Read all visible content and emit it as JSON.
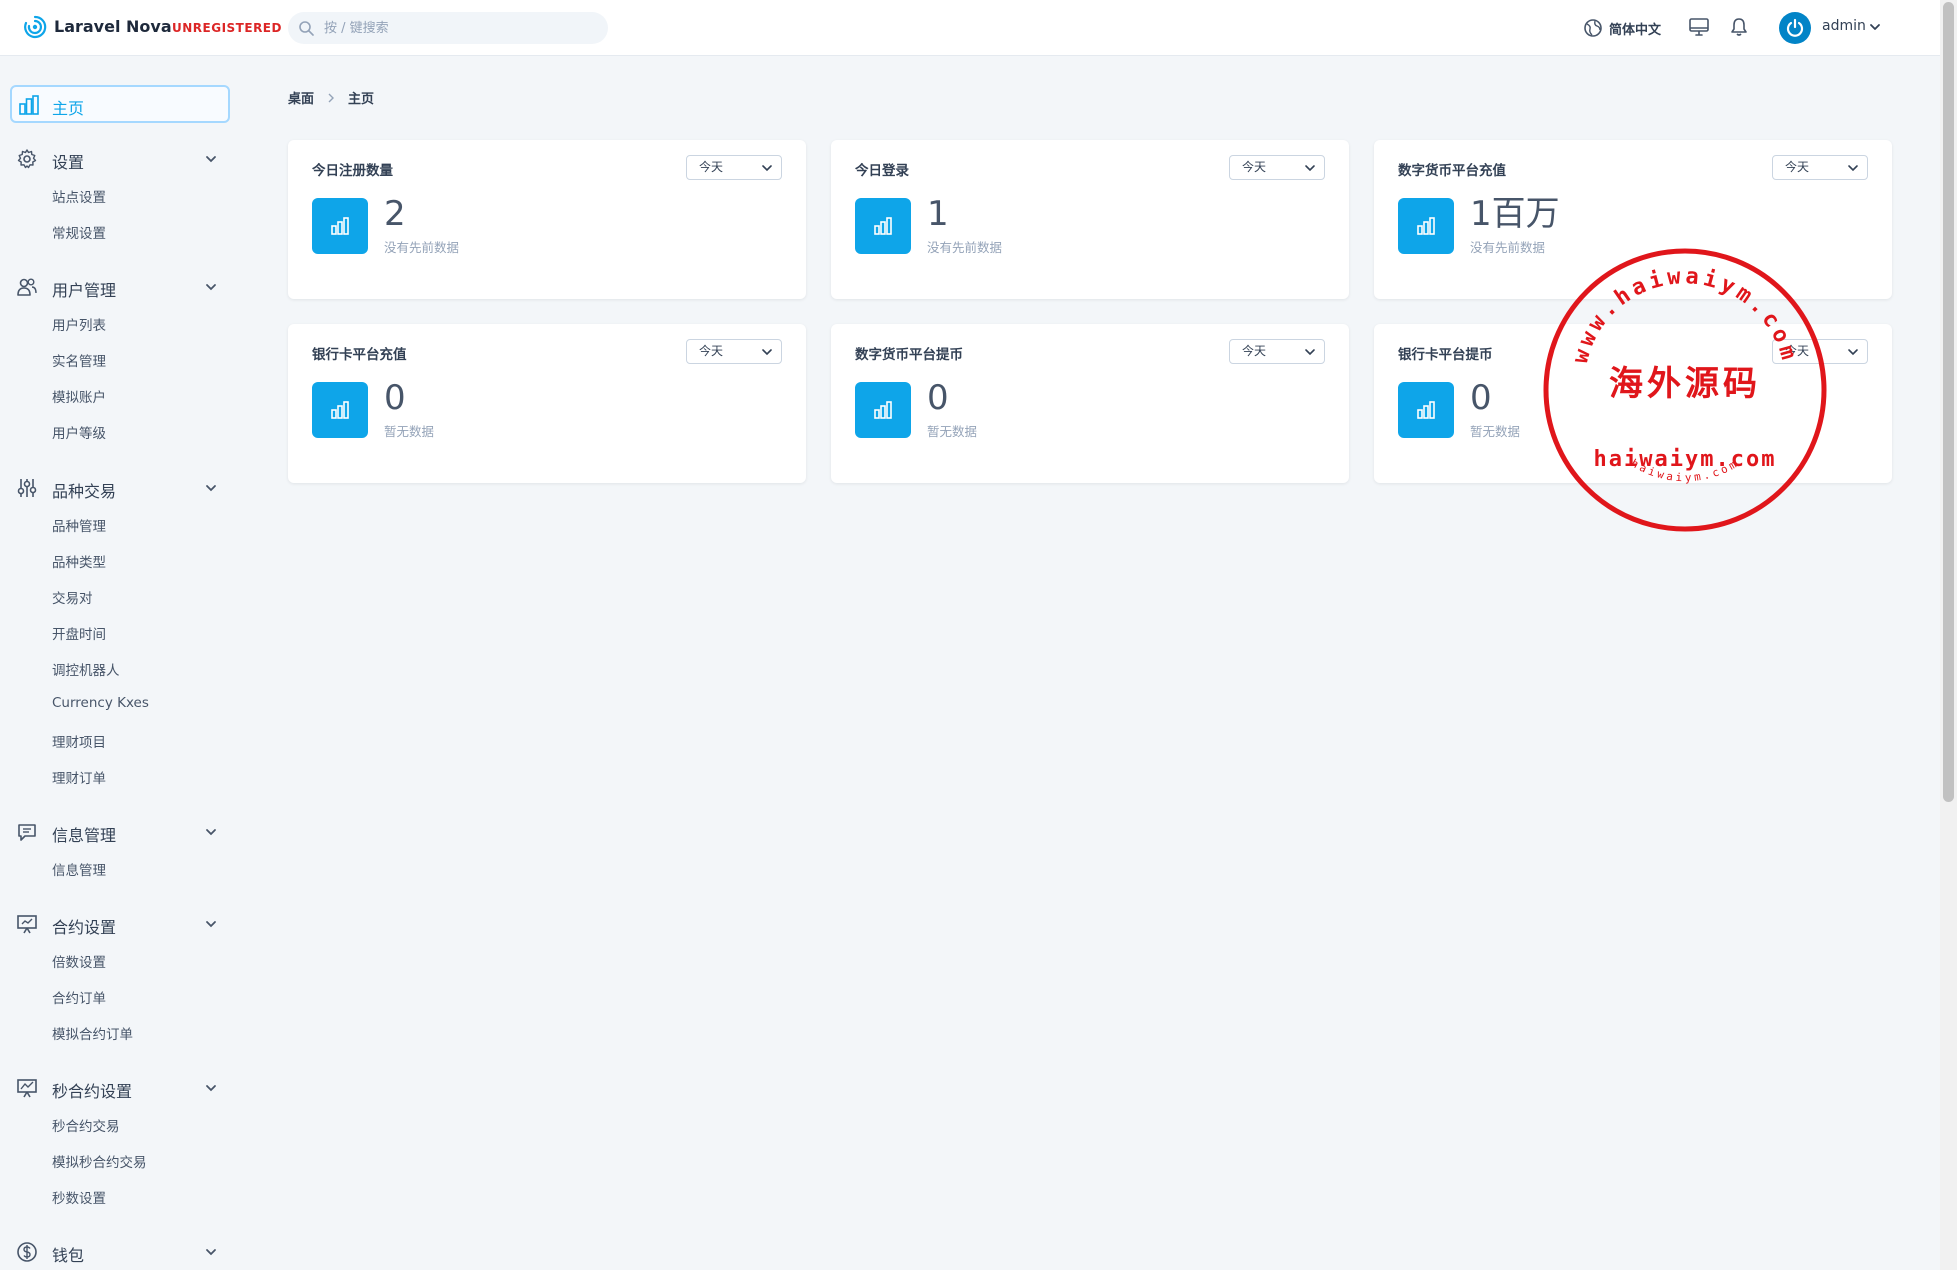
{
  "app": {
    "name": "Laravel Nova",
    "badge": "UNREGISTERED"
  },
  "search": {
    "placeholder": "按 / 键搜索"
  },
  "header": {
    "language": "简体中文",
    "user": "admin"
  },
  "sidebar": {
    "home": "主页",
    "groups": [
      {
        "label": "设置",
        "icon": "gear-icon",
        "items": [
          "站点设置",
          "常规设置"
        ]
      },
      {
        "label": "用户管理",
        "icon": "users-icon",
        "items": [
          "用户列表",
          "实名管理",
          "模拟账户",
          "用户等级"
        ]
      },
      {
        "label": "品种交易",
        "icon": "sliders-icon",
        "items": [
          "品种管理",
          "品种类型",
          "交易对",
          "开盘时间",
          "调控机器人",
          "Currency Kxes",
          "理财项目",
          "理财订单"
        ]
      },
      {
        "label": "信息管理",
        "icon": "message-icon",
        "items": [
          "信息管理"
        ]
      },
      {
        "label": "合约设置",
        "icon": "presentation-icon",
        "items": [
          "倍数设置",
          "合约订单",
          "模拟合约订单"
        ]
      },
      {
        "label": "秒合约设置",
        "icon": "trend-icon",
        "items": [
          "秒合约交易",
          "模拟秒合约交易",
          "秒数设置"
        ]
      },
      {
        "label": "钱包",
        "icon": "dollar-icon",
        "items": []
      }
    ]
  },
  "breadcrumb": [
    "桌面",
    "主页"
  ],
  "cards": [
    {
      "title": "今日注册数量",
      "range": "今天",
      "value": "2",
      "sub": "没有先前数据"
    },
    {
      "title": "今日登录",
      "range": "今天",
      "value": "1",
      "sub": "没有先前数据"
    },
    {
      "title": "数字货币平台充值",
      "range": "今天",
      "value": "1百万",
      "sub": "没有先前数据"
    },
    {
      "title": "银行卡平台充值",
      "range": "今天",
      "value": "0",
      "sub": "暂无数据"
    },
    {
      "title": "数字货币平台提币",
      "range": "今天",
      "value": "0",
      "sub": "暂无数据"
    },
    {
      "title": "银行卡平台提币",
      "range": "今天",
      "value": "0",
      "sub": "暂无数据"
    }
  ],
  "watermark": {
    "ring": "www.haiwaiym.com",
    "center": "海外源码",
    "domain": "haiwaiym.com",
    "small": "haiwaiym.com"
  },
  "colors": {
    "accent": "#0ea5e9",
    "brand_red": "#dc2626",
    "stamp_red": "#e0161b"
  }
}
